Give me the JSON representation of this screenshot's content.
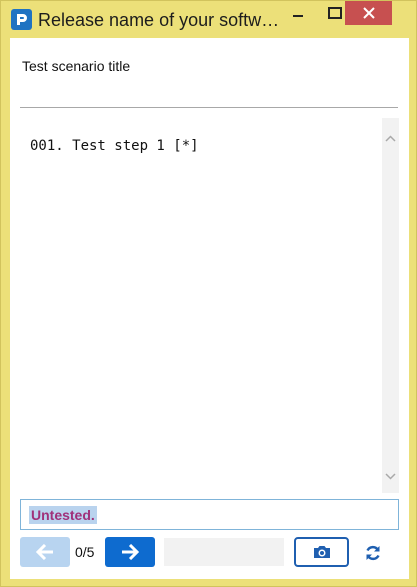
{
  "window": {
    "title": "Release name of your softw…",
    "accent_color": "#ece079",
    "close_color": "#c75050"
  },
  "scenario": {
    "title": "Test scenario title"
  },
  "steps": {
    "items": [
      {
        "label": "001. Test step 1 [*]"
      }
    ]
  },
  "status": {
    "text": "Untested.",
    "color": "#a0307a"
  },
  "toolbar": {
    "counter": "0/5",
    "icons": {
      "prev": "arrow-left-icon",
      "next": "arrow-right-icon",
      "camera": "camera-icon",
      "refresh": "refresh-icon"
    }
  }
}
